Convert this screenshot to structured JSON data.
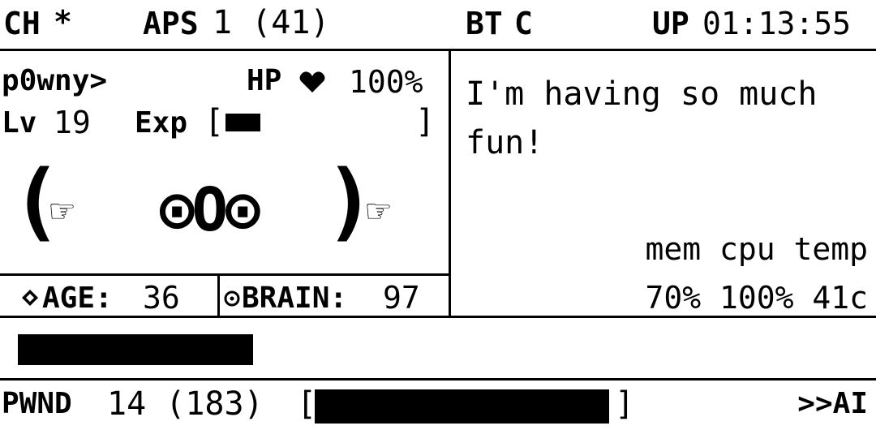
{
  "top_bar": {
    "ch_label": "CH",
    "ch_value": "*",
    "aps_label": "APS",
    "aps_value": "1 (41)",
    "bt_label": "BT",
    "bt_value": "C",
    "up_label": "UP",
    "up_value": "01:13:55"
  },
  "status": {
    "name": "p0wny>",
    "hp_label": "HP",
    "hp_icon": "heart-icon",
    "hp_value": "100%",
    "level_label": "Lv",
    "level_value": "19",
    "exp_label": "Exp",
    "exp_open": "[",
    "exp_close": "]",
    "exp_fill": 0.19,
    "face": {
      "left_paren": "(",
      "left_hand": "☞",
      "eyes": "⊙O⊙",
      "right_paren": ")",
      "right_hand": "☞"
    },
    "age_label": "AGE:",
    "age_value": "36",
    "brain_label": "BRAIN:",
    "brain_value": "97"
  },
  "message": {
    "line1": "I'm having so much",
    "line2": "fun!"
  },
  "system": {
    "headers": "mem cpu temp",
    "values": "70% 100% 41c"
  },
  "progress": {
    "fill": 0.28
  },
  "bottom_bar": {
    "pwnd_label": "PWND",
    "pwnd_value": "14 (183)",
    "bracket_open": "[",
    "bracket_close": "]",
    "pwnd_fill": 0.98,
    "mode": ">>AI"
  }
}
